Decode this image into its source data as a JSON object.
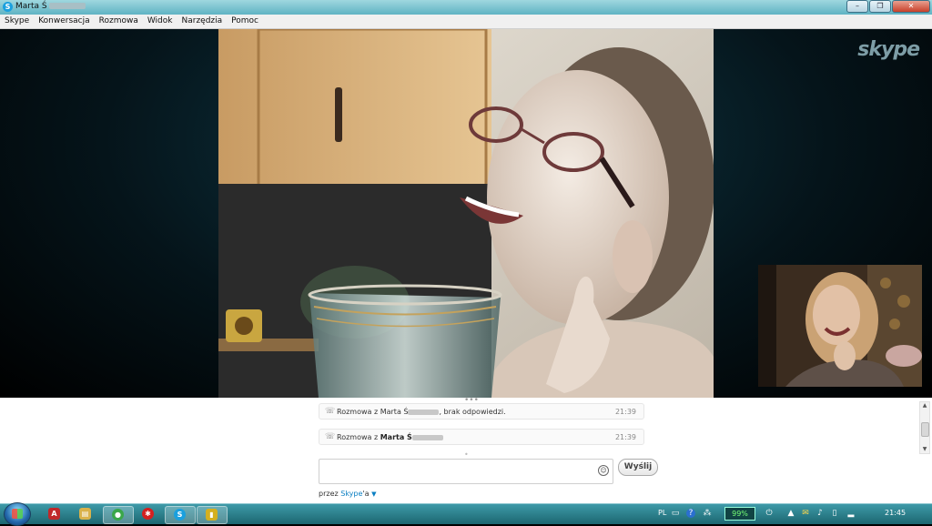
{
  "window": {
    "title": "Marta Ś",
    "icon": "skype-icon",
    "controls": [
      "minimize-icon",
      "maximize-icon",
      "close-icon"
    ]
  },
  "menu": {
    "items": [
      "Skype",
      "Konwersacja",
      "Rozmowa",
      "Widok",
      "Narzędzia",
      "Pomoc"
    ]
  },
  "video": {
    "brand_logo": "skype"
  },
  "chat": {
    "messages": [
      {
        "prefix": "Rozmowa z Marta Ś",
        "suffix": ", brak odpowiedzi.",
        "time": "21:39",
        "icon": "phone-icon"
      },
      {
        "prefix": "Rozmowa z ",
        "name": "Marta Ś",
        "time": "21:39",
        "icon": "phone-icon"
      }
    ],
    "input_placeholder": "",
    "send_label": "Wyślij",
    "via_prefix": "przez ",
    "via_brand": "Skype",
    "via_suffix": "'a"
  },
  "taskbar": {
    "apps": [
      {
        "name": "start-orb"
      },
      {
        "name": "pdf-app-icon",
        "color": "#c0282a"
      },
      {
        "name": "explorer-icon",
        "color": "#d9b24a"
      },
      {
        "name": "chrome-icon",
        "color": "#3aa74a"
      },
      {
        "name": "red-app-icon",
        "color": "#d42020"
      },
      {
        "name": "skype-taskbar-icon",
        "color": "#1aa0de"
      },
      {
        "name": "winamp-icon",
        "color": "#d4b020"
      }
    ],
    "tray": {
      "lang": "PL",
      "battery": "99%",
      "clock": "21:45"
    }
  },
  "colors": {
    "skype_blue": "#1aa0de",
    "taskbar": "#2a7f8a"
  }
}
